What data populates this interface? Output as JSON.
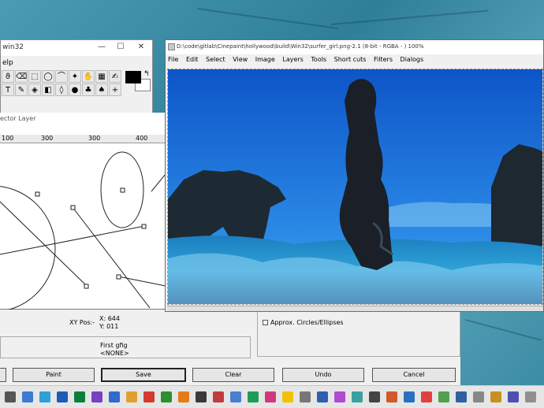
{
  "tools_window": {
    "title": "win32",
    "menu": "elp",
    "controls": {
      "minimize": "—",
      "maximize": "☐",
      "close": "✕"
    },
    "tools": [
      {
        "name": "lasso-icon",
        "glyph": "ϑ"
      },
      {
        "name": "eraser-icon",
        "glyph": "⌫"
      },
      {
        "name": "rect-select-icon",
        "glyph": "⬚"
      },
      {
        "name": "ellipse-select-icon",
        "glyph": "◯"
      },
      {
        "name": "freehand-icon",
        "glyph": "⌒"
      },
      {
        "name": "magic-wand-icon",
        "glyph": "✦"
      },
      {
        "name": "hand-icon",
        "glyph": "✋"
      },
      {
        "name": "gradient-icon",
        "glyph": "▦"
      },
      {
        "name": "smudge-icon",
        "glyph": "✍"
      },
      {
        "name": "text-icon",
        "glyph": "T"
      },
      {
        "name": "pencil-icon",
        "glyph": "✎"
      },
      {
        "name": "fill-icon",
        "glyph": "◈"
      },
      {
        "name": "rect-fill-icon",
        "glyph": "◧"
      },
      {
        "name": "drop-icon",
        "glyph": "◊"
      },
      {
        "name": "brush-icon",
        "glyph": "●"
      },
      {
        "name": "stamp-icon",
        "glyph": "♣"
      },
      {
        "name": "clone-icon",
        "glyph": "♠"
      },
      {
        "name": "extra-icon",
        "glyph": "+"
      }
    ],
    "swap_glyph": "↰"
  },
  "vector_window": {
    "title": "ector Layer",
    "ruler_labels": [
      "100",
      "300",
      "300",
      "400"
    ]
  },
  "bottom_panel": {
    "xy_label": "XY Pos:-",
    "x_label": "X: 644",
    "y_label": "Y: 011",
    "first_label": "First gfig",
    "none_label": "<NONE>",
    "approx_label": "Approx. Circles/Ellipses",
    "buttons": [
      "Paint",
      "Save",
      "Clear",
      "Undo",
      "Cancel"
    ]
  },
  "image_window": {
    "title": "D:\\code\\gitlab\\Cinepaint\\hollywood\\build\\Win32\\surfer_girl.png-2.1 (8-bit - RGBA - ) 100%",
    "menu": [
      "File",
      "Edit",
      "Select",
      "View",
      "Image",
      "Layers",
      "Tools",
      "Short cuts",
      "Filters",
      "Dialogs"
    ]
  },
  "colors": {
    "sky": "#1a6fd6",
    "sea": "#1b8fc9",
    "desktop": "#3f8fa5"
  }
}
